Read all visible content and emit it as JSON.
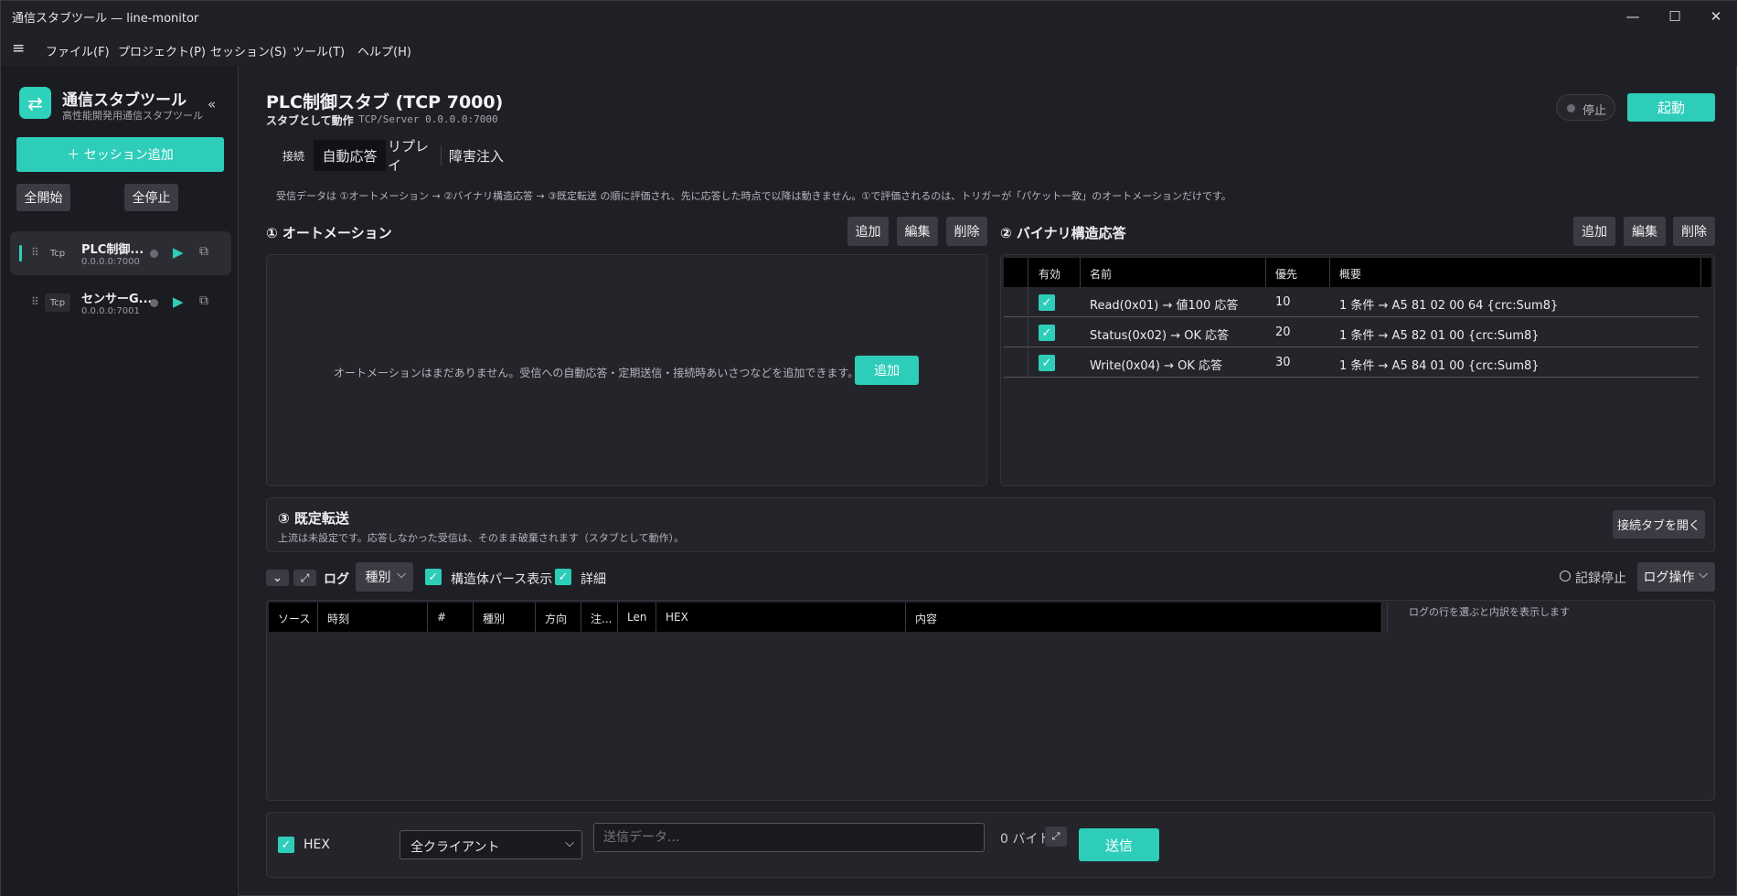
{
  "window": {
    "title": "通信スタブツール — line-monitor",
    "controls": [
      "—",
      "☐",
      "✕"
    ]
  },
  "menu": {
    "hamburger": "≡",
    "items": [
      "ファイル(F)",
      "プロジェクト(P)",
      "セッション(S)",
      "ツール(T)",
      "ヘルプ(H)"
    ]
  },
  "sidebar": {
    "app_name": "通信スタブツール",
    "app_sub": "高性能開発用通信スタブツール",
    "logo_glyph": "⇄",
    "collapse": "«",
    "add_session": "＋ セッション追加",
    "start_all": "全開始",
    "stop_all": "全停止",
    "sessions": [
      {
        "proto": "Tcp",
        "name": "PLC制御...",
        "addr": "0.0.0.0:7000",
        "active": true
      },
      {
        "proto": "Tcp",
        "name": "センサーG...",
        "addr": "0.0.0.0:7001",
        "active": false
      }
    ]
  },
  "header": {
    "title": "PLC制御スタブ (TCP 7000)",
    "mode": "スタブとして動作",
    "endpoint": "· TCP/Server 0.0.0.0:7000",
    "status": "停止",
    "start": "起動"
  },
  "tabs": [
    "接続",
    "自動応答",
    "リプレイ",
    "障害注入"
  ],
  "info": "受信データは ①オートメーション → ②バイナリ構造応答 → ③既定転送 の順に評価され、先に応答した時点で以降は動きません。①で評価されるのは、トリガーが「パケット一致」のオートメーションだけです。",
  "automation": {
    "title": "① オートメーション",
    "add": "追加",
    "edit": "編集",
    "delete": "削除",
    "empty": "オートメーションはまだありません。受信への自動応答・定期送信・接続時あいさつなどを追加できます。",
    "empty_add": "追加"
  },
  "binary": {
    "title": "② バイナリ構造応答",
    "add": "追加",
    "edit": "編集",
    "delete": "削除",
    "columns": [
      "有効",
      "名前",
      "優先",
      "概要"
    ],
    "rows": [
      {
        "enabled": "✓",
        "name": "Read(0x01) → 値100 応答",
        "priority": "10",
        "summary": "1 条件 → A5 81 02 00 64 {crc:Sum8}"
      },
      {
        "enabled": "✓",
        "name": "Status(0x02) → OK 応答",
        "priority": "20",
        "summary": "1 条件 → A5 82 01 00 {crc:Sum8}"
      },
      {
        "enabled": "✓",
        "name": "Write(0x04) → OK 応答",
        "priority": "30",
        "summary": "1 条件 → A5 84 01 00 {crc:Sum8}"
      }
    ]
  },
  "forward": {
    "title": "③ 既定転送",
    "desc": "上流は未設定です。応答しなかった受信は、そのまま破棄されます（スタブとして動作）。",
    "open_tab": "接続タブを開く"
  },
  "log": {
    "collapse": "⌄",
    "expand": "⤢",
    "label": "ログ",
    "kind": "種別",
    "struct_parse": "構造体パース表示",
    "detail": "詳細",
    "record_stop": "記録停止",
    "log_ops": "ログ操作",
    "columns": [
      "ソース",
      "時刻",
      "#",
      "種別",
      "方向",
      "注...",
      "Len",
      "HEX",
      "内容"
    ],
    "detail_hint": "ログの行を選ぶと内訳を表示します"
  },
  "send": {
    "hex": "HEX",
    "target": "全クライアント",
    "placeholder": "送信データ...",
    "bytes": "0 バイト",
    "send": "送信"
  }
}
